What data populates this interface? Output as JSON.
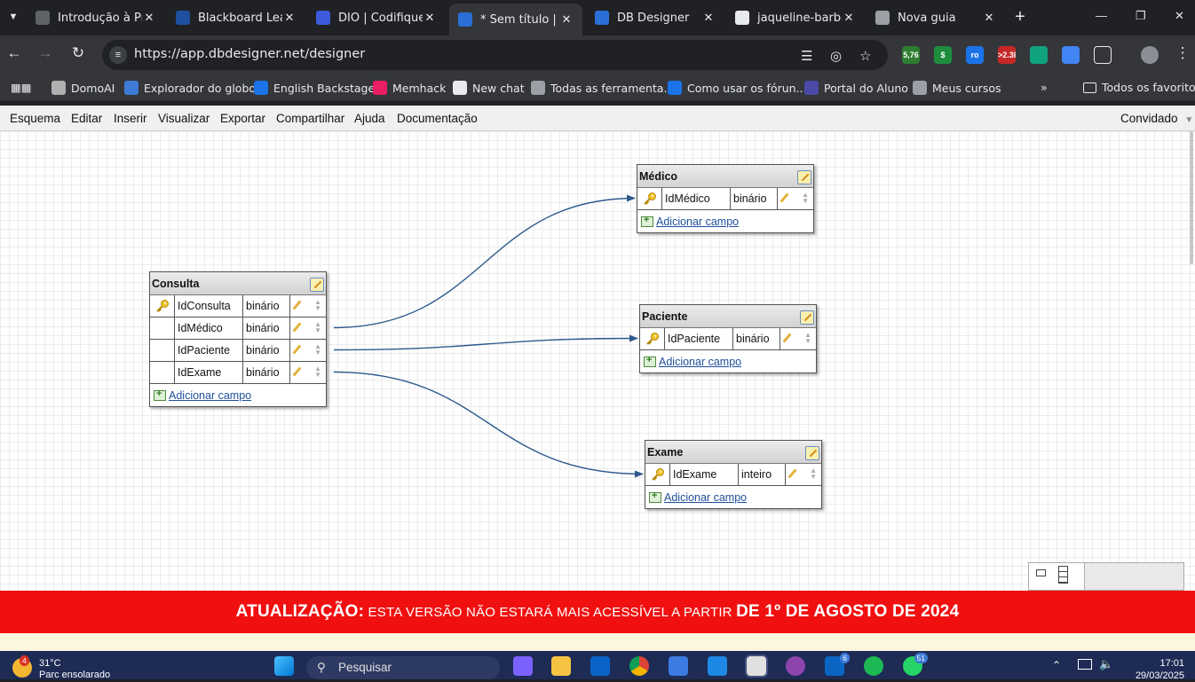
{
  "browser": {
    "tabs": [
      {
        "title": "Introdução à Pro",
        "favicon": "flow-icon",
        "color": "#5f6368"
      },
      {
        "title": "Blackboard Learn",
        "favicon": "blackboard-icon",
        "color": "#1f4fa0"
      },
      {
        "title": "DIO | Codifique o",
        "favicon": "dio-icon",
        "color": "#3b5bdb"
      },
      {
        "title": "* Sem título | DbD",
        "favicon": "dbdesigner-icon",
        "color": "#2a6fd6",
        "active": true
      },
      {
        "title": "DB Designer",
        "favicon": "database-icon",
        "color": "#2a6fd6"
      },
      {
        "title": "jaqueline-barbosa",
        "favicon": "github-icon",
        "color": "#e8eaed"
      },
      {
        "title": "Nova guia",
        "favicon": "chrome-icon",
        "color": "#9aa0a6"
      }
    ],
    "url": "https://app.dbdesigner.net/designer",
    "extensions": [
      {
        "name": "weather-extension-icon",
        "label": "5,76",
        "color": "#2e7d32"
      },
      {
        "name": "dollar-extension-icon",
        "label": "$",
        "color": "#1e8e3e"
      },
      {
        "name": "ro-extension-icon",
        "label": "ro",
        "color": "#1a73e8"
      },
      {
        "name": "calendar-extension-icon",
        "label": ">2.3l",
        "color": "#c62828"
      },
      {
        "name": "chatgpt-extension-icon",
        "label": "",
        "color": "#10a37f"
      },
      {
        "name": "cursor-extension-icon",
        "label": "",
        "color": "#4285f4"
      }
    ],
    "bookmarks": [
      {
        "label": "DomoAI",
        "icon": "domoai-icon",
        "color": "#b0b0b0"
      },
      {
        "label": "Explorador do globo",
        "icon": "globe-icon",
        "color": "#3d7bd6"
      },
      {
        "label": "English Backstage",
        "icon": "k-icon",
        "color": "#1a73e8"
      },
      {
        "label": "Memhack",
        "icon": "memhack-icon",
        "color": "#e91e63"
      },
      {
        "label": "New chat",
        "icon": "openai-icon",
        "color": "#e8eaed"
      },
      {
        "label": "Todas as ferramenta...",
        "icon": "globe-icon",
        "color": "#9aa0a6"
      },
      {
        "label": "Como usar os fórun...",
        "icon": "c-icon",
        "color": "#1a73e8"
      },
      {
        "label": "Portal do Aluno",
        "icon": "portal-icon",
        "color": "#4a4aa8"
      },
      {
        "label": "Meus cursos",
        "icon": "globe-icon",
        "color": "#9aa0a6"
      }
    ],
    "all_bookmarks": "Todos os favoritos"
  },
  "app": {
    "menu": [
      "Esquema",
      "Editar",
      "Inserir",
      "Visualizar",
      "Exportar",
      "Compartilhar",
      "Ajuda",
      "Documentação"
    ],
    "user": "Convidado",
    "add_field_label": "Adicionar campo",
    "entities": [
      {
        "name": "Médico",
        "fields": [
          {
            "name": "IdMédico",
            "type": "binário",
            "primary_key": true
          }
        ]
      },
      {
        "name": "Consulta",
        "fields": [
          {
            "name": "IdConsulta",
            "type": "binário",
            "primary_key": true
          },
          {
            "name": "IdMédico",
            "type": "binário",
            "primary_key": false
          },
          {
            "name": "IdPaciente",
            "type": "binário",
            "primary_key": false
          },
          {
            "name": "IdExame",
            "type": "binário",
            "primary_key": false
          }
        ]
      },
      {
        "name": "Paciente",
        "fields": [
          {
            "name": "IdPaciente",
            "type": "binário",
            "primary_key": true
          }
        ]
      },
      {
        "name": "Exame",
        "fields": [
          {
            "name": "IdExame",
            "type": "inteiro",
            "primary_key": true
          }
        ]
      }
    ],
    "relations": [
      {
        "from": "Consulta.IdMédico",
        "to": "Médico.IdMédico"
      },
      {
        "from": "Consulta.IdPaciente",
        "to": "Paciente.IdPaciente"
      },
      {
        "from": "Consulta.IdExame",
        "to": "Exame.IdExame"
      }
    ],
    "banner": {
      "lead": "ATUALIZAÇÃO:",
      "text": " ESTA VERSÃO NÃO ESTARÁ MAIS ACESSÍVEL A PARTIR ",
      "date": "DE 1º DE AGOSTO DE 2024"
    },
    "link_color": "#2c5a8c"
  },
  "taskbar": {
    "weather_temp": "31°C",
    "weather_desc": "Parc ensolarado",
    "weather_badge": "4",
    "search_placeholder": "Pesquisar",
    "linkedin_badge": "6",
    "whatsapp_badge": "51",
    "time": "17:01",
    "date": "29/03/2025"
  }
}
